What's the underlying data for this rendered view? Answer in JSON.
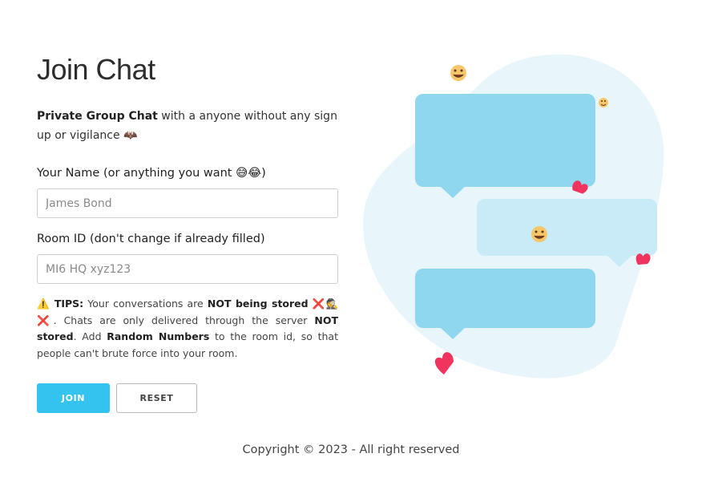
{
  "title": "Join Chat",
  "intro": {
    "bold": "Private Group Chat",
    "text": " with a anyone without any sign up or vigilance 🦇"
  },
  "name_field": {
    "label": "Your Name (or anything you want 😅😂)",
    "placeholder": "James Bond",
    "value": ""
  },
  "room_field": {
    "label": "Room ID (don't change if already filled)",
    "placeholder": "MI6 HQ xyz123",
    "value": ""
  },
  "tips": {
    "warning_icon": "⚠️",
    "label": "TIPS:",
    "t1": " Your conversations are ",
    "b1": "NOT being stored",
    "t2": " ❌🕵❌. Chats are only delivered through the server ",
    "b2": "NOT stored",
    "t3": ". Add ",
    "b3": "Random Numbers",
    "t4": " to the room id, so that people can't brute force into your room."
  },
  "buttons": {
    "join": "JOIN",
    "reset": "RESET"
  },
  "footer": "Copyright © 2023 - All right reserved",
  "colors": {
    "primary": "#34c3ee",
    "bubble_dark": "#8fd6ef",
    "bubble_light": "#c8ebf7",
    "blob": "#e8f6fb",
    "heart": "#f0345e"
  }
}
